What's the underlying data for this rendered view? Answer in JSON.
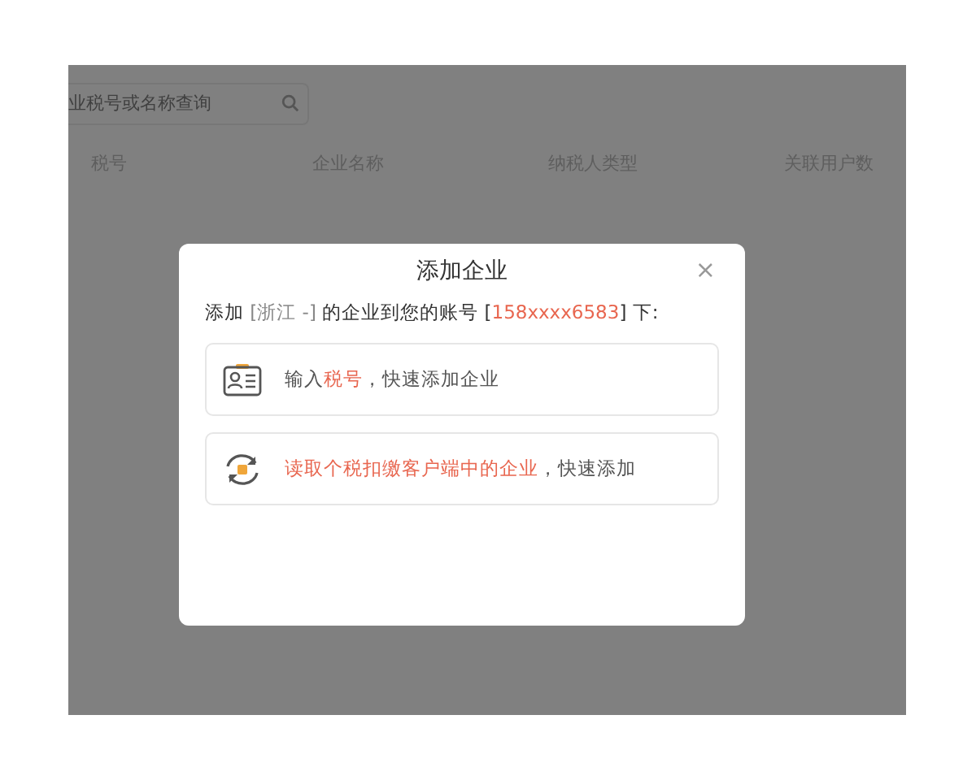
{
  "background": {
    "search": {
      "placeholder": "业税号或名称查询"
    },
    "table": {
      "columns": [
        "税号",
        "企业名称",
        "纳税人类型",
        "关联用户数"
      ]
    }
  },
  "dialog": {
    "title": "添加企业",
    "close": "×",
    "intro": [
      {
        "text": "添加 ",
        "kind": "plain"
      },
      {
        "text": "[浙江 -]",
        "kind": "muted"
      },
      {
        "text": " 的企业到您的账号 [",
        "kind": "plain"
      },
      {
        "text": "158xxxx6583",
        "kind": "accent"
      },
      {
        "text": "] 下:",
        "kind": "plain"
      }
    ],
    "options": [
      {
        "segments": [
          {
            "text": "输入",
            "kind": "plain"
          },
          {
            "text": "税号",
            "kind": "accent"
          },
          {
            "text": "，快速添加企业",
            "kind": "plain"
          }
        ]
      },
      {
        "segments": [
          {
            "text": "读取个税扣缴客户端中的企业",
            "kind": "accent"
          },
          {
            "text": "，快速添加",
            "kind": "plain"
          }
        ]
      }
    ]
  }
}
